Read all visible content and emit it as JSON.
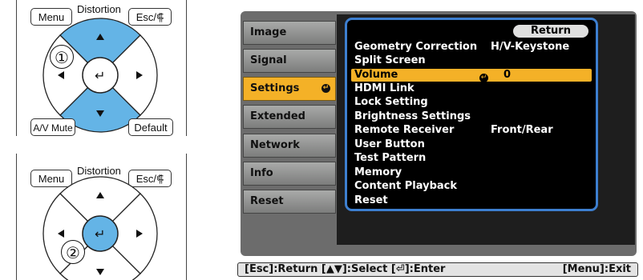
{
  "remote_top": {
    "menu_label": "Menu",
    "distortion_label": "Distortion",
    "esc_label": "Esc/⸿",
    "av_mute_label": "A/V Mute",
    "default_label": "Default",
    "step_number": "①"
  },
  "remote_bottom": {
    "menu_label": "Menu",
    "distortion_label": "Distortion",
    "esc_label": "Esc/⸿",
    "step_number": "②"
  },
  "menu": {
    "tabs": [
      {
        "label": "Image"
      },
      {
        "label": "Signal"
      },
      {
        "label": "Settings"
      },
      {
        "label": "Extended"
      },
      {
        "label": "Network"
      },
      {
        "label": "Info"
      },
      {
        "label": "Reset"
      }
    ],
    "return_label": "Return",
    "items": [
      {
        "label": "Geometry Correction",
        "value": "H/V-Keystone"
      },
      {
        "label": "Split Screen",
        "value": ""
      },
      {
        "label": "Volume",
        "value": "0"
      },
      {
        "label": "HDMI Link",
        "value": ""
      },
      {
        "label": "Lock Setting",
        "value": ""
      },
      {
        "label": "Brightness Settings",
        "value": ""
      },
      {
        "label": "Remote Receiver",
        "value": "Front/Rear"
      },
      {
        "label": "User Button",
        "value": ""
      },
      {
        "label": "Test Pattern",
        "value": ""
      },
      {
        "label": "Memory",
        "value": ""
      },
      {
        "label": "Content Playback",
        "value": ""
      },
      {
        "label": "Reset",
        "value": ""
      }
    ]
  },
  "footer": {
    "left_text": "[Esc]:Return [▲▼]:Select [⏎]:Enter",
    "right_text": "[Menu]:Exit"
  },
  "colors": {
    "highlight": "#f4b127",
    "frame_blue": "#3d7fd0",
    "tab_gray": "#8f908f",
    "pad_blue": "#64b4e6"
  }
}
